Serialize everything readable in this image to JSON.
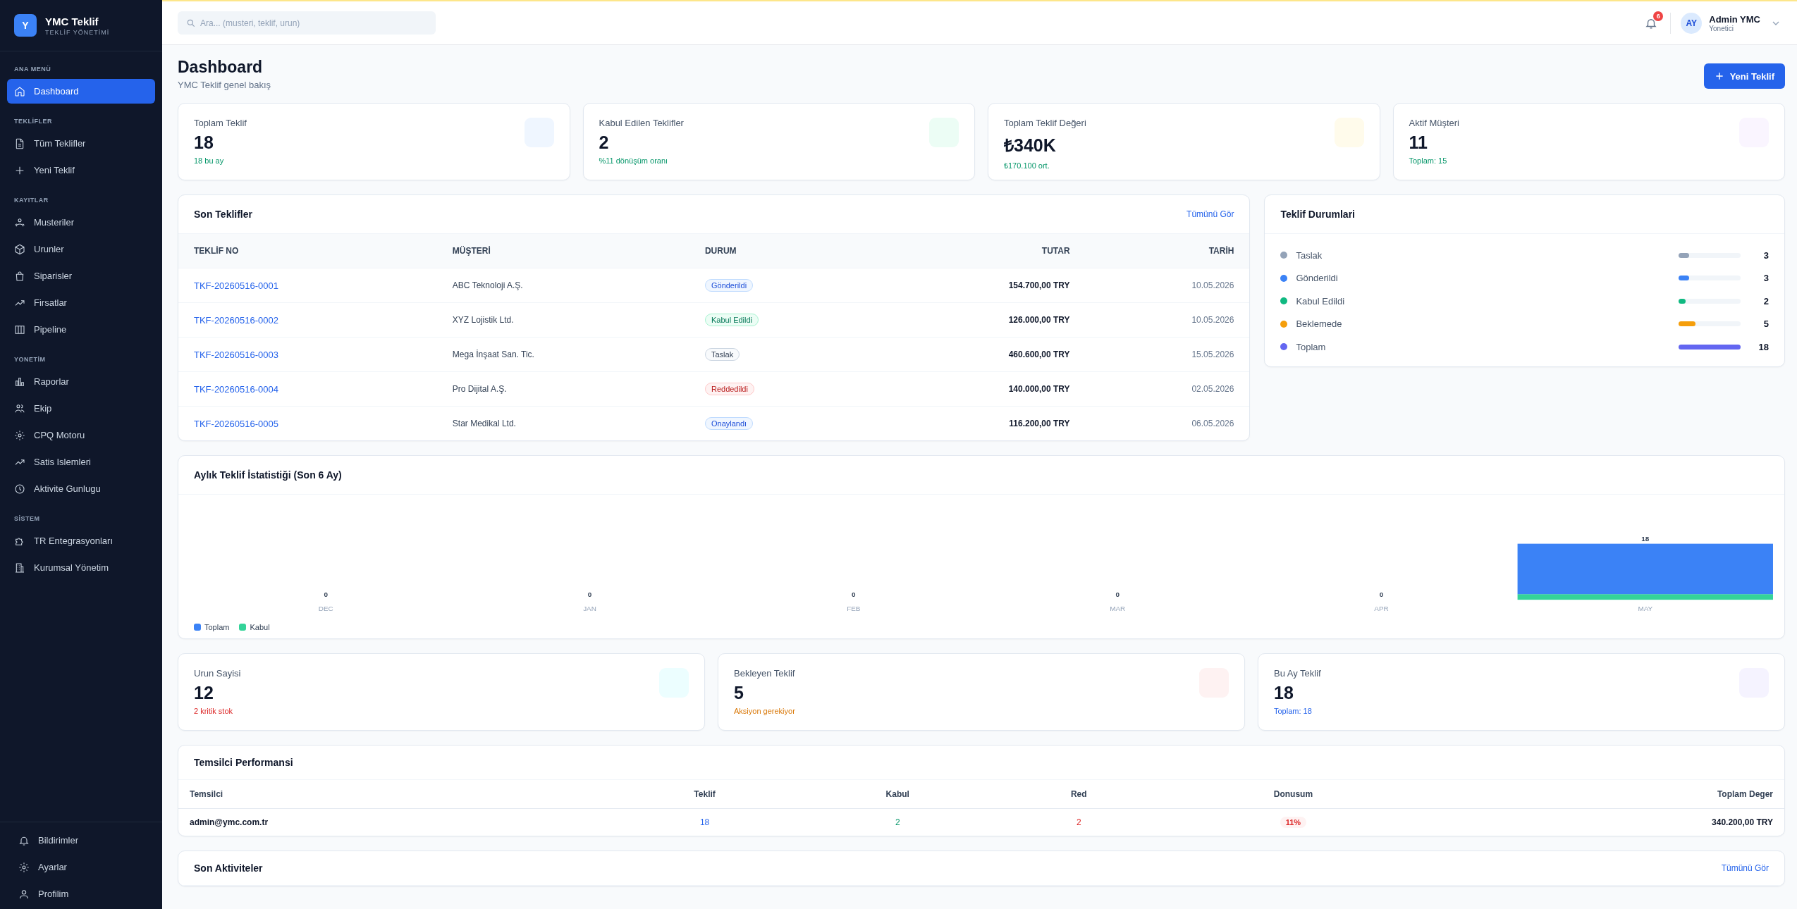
{
  "sidebar": {
    "logo_letter": "Y",
    "brand": "YMC Teklif",
    "tagline": "TEKLİF YÖNETİMİ",
    "sections": [
      {
        "title": "ANA MENÜ",
        "items": [
          {
            "label": "Dashboard",
            "selected": true
          }
        ]
      },
      {
        "title": "TEKLİFLER",
        "items": [
          {
            "label": "Tüm Teklifler",
            "selected": false
          },
          {
            "label": "Yeni Teklif",
            "selected": false
          }
        ]
      },
      {
        "title": "KAYITLAR",
        "items": [
          {
            "label": "Musteriler",
            "selected": false
          },
          {
            "label": "Urunler",
            "selected": false
          },
          {
            "label": "Siparisler",
            "selected": false
          },
          {
            "label": "Firsatlar",
            "selected": false
          },
          {
            "label": "Pipeline",
            "selected": false
          }
        ]
      },
      {
        "title": "YONETİM",
        "items": [
          {
            "label": "Raporlar",
            "selected": false
          },
          {
            "label": "Ekip",
            "selected": false
          },
          {
            "label": "CPQ Motoru",
            "selected": false
          },
          {
            "label": "Satis Islemleri",
            "selected": false
          },
          {
            "label": "Aktivite Gunlugu",
            "selected": false
          }
        ]
      },
      {
        "title": "SİSTEM",
        "items": [
          {
            "label": "TR Entegrasyonları",
            "selected": false
          },
          {
            "label": "Kurumsal Yönetim",
            "selected": false
          }
        ]
      }
    ],
    "footer_items": [
      "Bildirimler",
      "Ayarlar",
      "Profilim"
    ]
  },
  "header": {
    "search": {
      "placeholder": "Ara... (musteri, teklif, urun)"
    },
    "notification_count": "6",
    "user": {
      "initials": "AY",
      "name": "Admin YMC",
      "role": "Yonetici"
    }
  },
  "page": {
    "title": "Dashboard",
    "subtitle": "YMC Teklif genel bakış",
    "new_button": "Yeni Teklif"
  },
  "stats": [
    {
      "label": "Toplam Teklif",
      "value": "18",
      "note": {
        "text": "18 bu ay",
        "color": "#059669"
      },
      "color": "#eff6ff"
    },
    {
      "label": "Kabul Edilen Teklifler",
      "value": "2",
      "note": {
        "text": "%11 dönüşüm oranı",
        "color": "#059669"
      },
      "color": "#ecfdf5"
    },
    {
      "label": "Toplam Teklif Değeri",
      "value": "₺340K",
      "note": {
        "text": "₺170.100 ort.",
        "color": "#059669"
      },
      "color": "#fffbeb"
    },
    {
      "label": "Aktif Müşteri",
      "value": "11",
      "note": {
        "text": "Toplam: 15",
        "color": "#059669"
      },
      "color": "#faf5ff"
    }
  ],
  "recent_quotes": {
    "title": "Son Teklifler",
    "link": "Tümünü Gör",
    "columns": [
      "TEKLİF NO",
      "MÜŞTERİ",
      "DURUM",
      "TUTAR",
      "TARİH"
    ],
    "rows": [
      {
        "number": "TKF-20260516-0001",
        "customer": "ABC Teknoloji A.Ş.",
        "status": "Gönderildi",
        "kind": "sent",
        "amount": "154.700,00 TRY",
        "date": "10.05.2026"
      },
      {
        "number": "TKF-20260516-0002",
        "customer": "XYZ Lojistik Ltd.",
        "status": "Kabul Edildi",
        "kind": "accepted",
        "amount": "126.000,00 TRY",
        "date": "10.05.2026"
      },
      {
        "number": "TKF-20260516-0003",
        "customer": "Mega İnşaat San. Tic.",
        "status": "Taslak",
        "kind": "draft",
        "amount": "460.600,00 TRY",
        "date": "15.05.2026"
      },
      {
        "number": "TKF-20260516-0004",
        "customer": "Pro Dijital A.Ş.",
        "status": "Reddedildi",
        "kind": "rejected",
        "amount": "140.000,00 TRY",
        "date": "02.05.2026"
      },
      {
        "number": "TKF-20260516-0005",
        "customer": "Star Medikal Ltd.",
        "status": "Onaylandı",
        "kind": "approved",
        "amount": "116.200,00 TRY",
        "date": "06.05.2026"
      }
    ]
  },
  "status_summary": {
    "title": "Teklif Durumlari",
    "items": [
      {
        "label": "Taslak",
        "color": "#94a3b8",
        "level": 0.167,
        "count": "3"
      },
      {
        "label": "Gönderildi",
        "color": "#3b82f6",
        "level": 0.167,
        "count": "3"
      },
      {
        "label": "Kabul Edildi",
        "color": "#10b981",
        "level": 0.111,
        "count": "2"
      },
      {
        "label": "Beklemede",
        "color": "#f59e0b",
        "level": 0.278,
        "count": "5"
      },
      {
        "label": "Toplam",
        "color": "#6366f1",
        "level": 1,
        "count": "18"
      }
    ]
  },
  "monthly_chart": {
    "title": "Aylık Teklif İstatistiği (Son 6 Ay)",
    "chart_data": {
      "type": "bar",
      "categories": [
        "DEC",
        "JAN",
        "FEB",
        "MAR",
        "APR",
        "MAY"
      ],
      "stacked": true,
      "legend": "bottom-left",
      "series": [
        {
          "name": "Kabul",
          "color": "#34d399",
          "values": [
            0,
            0,
            0,
            0,
            0,
            2
          ],
          "value_labels": [
            null,
            null,
            null,
            null,
            null,
            null
          ]
        },
        {
          "name": "Toplam",
          "color": "#3b82f6",
          "values": [
            0,
            0,
            0,
            0,
            0,
            18
          ],
          "value_labels": [
            "0",
            "0",
            "0",
            "0",
            "0",
            "18"
          ]
        }
      ]
    }
  },
  "mini_stats": [
    {
      "label": "Urun Sayisi",
      "value": "12",
      "note": {
        "text": "2 kritik stok",
        "color": "#dc2626"
      },
      "color": "#ecfeff"
    },
    {
      "label": "Bekleyen Teklif",
      "value": "5",
      "note": {
        "text": "Aksiyon gerekiyor",
        "color": "#d97706"
      },
      "color": "#fef2f2"
    },
    {
      "label": "Bu Ay Teklif",
      "value": "18",
      "note": {
        "text": "Toplam: 18",
        "color": "#2563eb"
      },
      "color": "#f5f3ff"
    }
  ],
  "rep_performance": {
    "title": "Temsilci Performansi",
    "columns": [
      "Temsilci",
      "Teklif",
      "Kabul",
      "Red",
      "Donusum",
      "Toplam Deger"
    ],
    "rows": [
      [
        "admin@ymc.com.tr",
        "18",
        "2",
        "2",
        "11%",
        "340.200,00 TRY"
      ]
    ]
  },
  "activities": {
    "title": "Son Aktiviteler",
    "link": "Tümünü Gör"
  }
}
